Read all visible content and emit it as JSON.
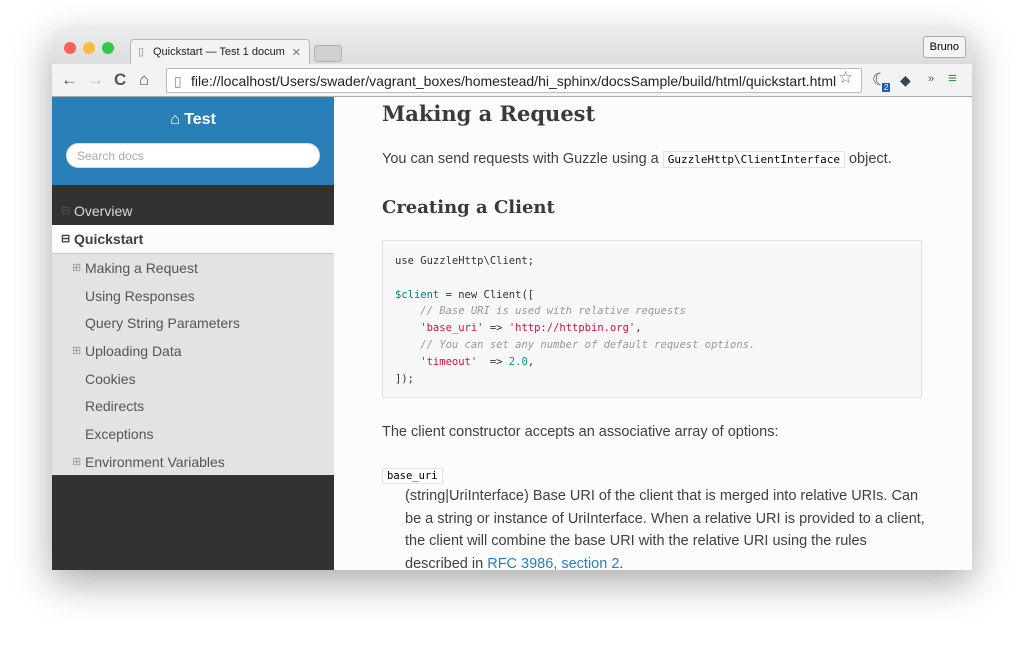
{
  "browser": {
    "tab_title": "Quickstart — Test 1 docum",
    "user": "Bruno",
    "url": "file://localhost/Users/swader/vagrant_boxes/homestead/hi_sphinx/docsSample/build/html/quickstart.html",
    "badge": "2"
  },
  "sidebar": {
    "project": "Test",
    "search_placeholder": "Search docs",
    "top": "Overview",
    "current": "Quickstart",
    "items": [
      {
        "label": "Making a Request",
        "expandable": true
      },
      {
        "label": "Using Responses"
      },
      {
        "label": "Query String Parameters"
      },
      {
        "label": "Uploading Data",
        "expandable": true
      },
      {
        "label": "Cookies"
      },
      {
        "label": "Redirects"
      },
      {
        "label": "Exceptions"
      },
      {
        "label": "Environment Variables",
        "expandable": true
      }
    ]
  },
  "main": {
    "h1": "Making a Request",
    "intro_pre": "You can send requests with Guzzle using a ",
    "intro_code": "GuzzleHttp\\ClientInterface",
    "intro_post": " object.",
    "h2": "Creating a Client",
    "code": {
      "l1": "use GuzzleHttp\\Client;",
      "var": "$client",
      "l3": " = new Client([",
      "c1": "    // Base URI is used with relative requests",
      "k1": "    'base_uri'",
      "arrow1": " => ",
      "v1": "'http://httpbin.org'",
      "end1": ",",
      "c2": "    // You can set any number of default request options.",
      "k2": "    'timeout'",
      "arrow2": "  => ",
      "v2": "2.0",
      "end2": ",",
      "l8": "]);"
    },
    "para2": "The client constructor accepts an associative array of options:",
    "option": "base_uri",
    "desc": "(string|UriInterface) Base URI of the client that is merged into relative URIs. Can be a string or instance of UriInterface. When a relative URI is provided to a client, the client will combine the base URI with the relative URI using the rules described in ",
    "link": "RFC 3986, section 2",
    "desc_end": "."
  }
}
